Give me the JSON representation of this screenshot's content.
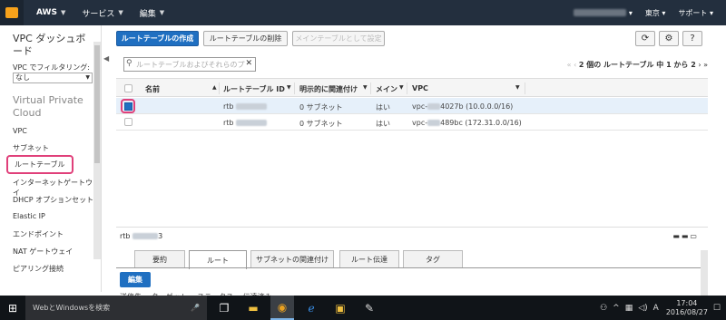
{
  "topbar": {
    "brand": "AWS",
    "services_label": "サービス",
    "edit_label": "編集",
    "region_label": "東京",
    "support_label": "サポート"
  },
  "sidebar": {
    "title": "VPC ダッシュボード",
    "filter_label": "VPC でフィルタリング:",
    "filter_value": "なし",
    "section": "Virtual Private Cloud",
    "items": [
      {
        "label": "VPC"
      },
      {
        "label": "サブネット"
      },
      {
        "label": "ルートテーブル"
      },
      {
        "label": "インターネットゲートウェイ"
      },
      {
        "label": "DHCP オプションセット"
      },
      {
        "label": "Elastic IP"
      },
      {
        "label": "エンドポイント"
      },
      {
        "label": "NAT ゲートウェイ"
      },
      {
        "label": "ピアリング接続"
      }
    ]
  },
  "toolbar": {
    "create_label": "ルートテーブルの作成",
    "delete_label": "ルートテーブルの削除",
    "set_main_label": "メインテーブルとして設定"
  },
  "search": {
    "placeholder": "ルートテーブルおよびそれらのプ"
  },
  "pager": {
    "text": "2 個の ルートテーブル 中 1 から 2"
  },
  "table": {
    "columns": [
      "名前",
      "ルートテーブル ID",
      "明示的に関連付け",
      "メイン",
      "VPC"
    ],
    "rows": [
      {
        "name": "",
        "id_prefix": "rtb",
        "assoc": "0 サブネット",
        "main": "はい",
        "vpc_prefix": "vpc-",
        "vpc_suffix": "4027b (10.0.0.0/16)",
        "selected": true
      },
      {
        "name": "",
        "id_prefix": "rtb",
        "assoc": "0 サブネット",
        "main": "はい",
        "vpc_prefix": "vpc-",
        "vpc_suffix": "489bc (172.31.0.0/16)",
        "selected": false
      }
    ]
  },
  "detail": {
    "title_prefix": "rtb",
    "title_suffix": "3",
    "tabs": [
      "要約",
      "ルート",
      "サブネットの関連付け",
      "ルート伝達",
      "タグ"
    ],
    "active_tab": "ルート",
    "edit_label": "編集",
    "sub_headers": "送信先　 ターゲット　 ステータス　 伝達済み"
  },
  "taskbar": {
    "search_placeholder": "WebとWindowsを検索",
    "time": "17:04",
    "date": "2016/08/27"
  }
}
